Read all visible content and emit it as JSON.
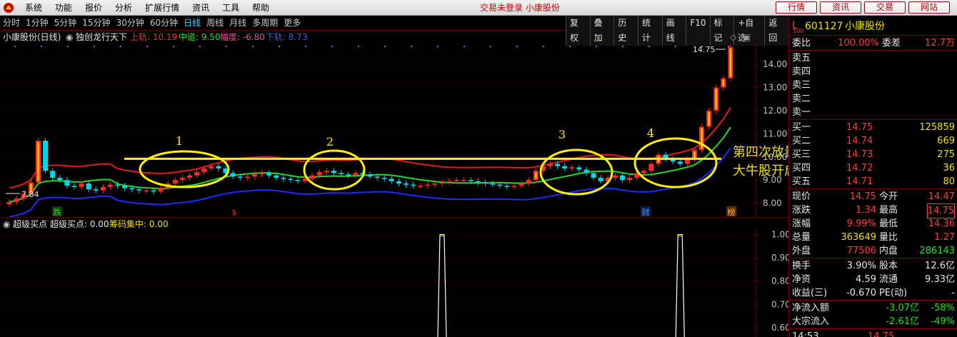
{
  "menu": {
    "items": [
      "系统",
      "功能",
      "报价",
      "分析",
      "扩展行情",
      "资讯",
      "工具",
      "帮助"
    ],
    "status": "交易未登录  小康股份",
    "right_buttons": [
      "行情",
      "资讯",
      "交易",
      "网站"
    ]
  },
  "periodbar": {
    "tabs": [
      "分时",
      "1分钟",
      "5分钟",
      "15分钟",
      "30分钟",
      "60分钟",
      "日线",
      "周线",
      "月线",
      "多周期",
      "更多"
    ],
    "active": "日线",
    "tools": [
      "复权",
      "叠加",
      "历史",
      "统计",
      "画线",
      "F10",
      "标记",
      "+自选",
      "返回"
    ]
  },
  "chart_header": {
    "title": "小康股份(日线)",
    "indicator": "独创龙行天下",
    "upper_label": "上轨: 10.19",
    "mid_label": "中道: 9.50",
    "amp_label": "幅度: -6.80",
    "lower_label": "下轨: 8.73"
  },
  "annotations": {
    "circle_labels": [
      "1",
      "2",
      "3",
      "4"
    ],
    "note_line1": "第四次放量站上红线",
    "note_line2": "大牛股开启",
    "price_high_label": "14.75",
    "price_low_label": "7.84",
    "bottom_markers": [
      "跌",
      "$",
      "财",
      "榜"
    ]
  },
  "sub_header": {
    "name": "超级买点",
    "value_label": "超级买点: 0.00",
    "chip_label": "筹码集中: 0.00"
  },
  "chart_data": [
    {
      "type": "candlestick",
      "title": "小康股份(日线)",
      "y_axis_ticks": [
        "14.00",
        "13.00",
        "12.00",
        "11.00",
        "10.00",
        "9.00",
        "8.00"
      ],
      "ylim": [
        7.4,
        14.9
      ],
      "closes": [
        8.05,
        8.2,
        8.4,
        8.9,
        10.7,
        9.4,
        9.1,
        9.0,
        8.75,
        8.7,
        8.85,
        8.6,
        8.55,
        8.7,
        8.8,
        8.75,
        8.65,
        8.6,
        8.55,
        8.55,
        8.5,
        8.65,
        8.85,
        9.0,
        9.1,
        9.2,
        9.35,
        9.5,
        9.6,
        9.5,
        9.3,
        9.15,
        9.1,
        9.15,
        9.25,
        9.3,
        9.2,
        9.1,
        9.05,
        9.0,
        8.95,
        9.05,
        9.2,
        9.35,
        9.4,
        9.3,
        9.25,
        9.2,
        9.3,
        9.25,
        9.15,
        9.1,
        9.05,
        8.95,
        8.85,
        8.8,
        8.75,
        8.75,
        8.8,
        8.85,
        8.9,
        8.95,
        9.0,
        9.0,
        8.95,
        8.9,
        8.85,
        8.8,
        8.75,
        8.7,
        8.75,
        8.85,
        9.0,
        9.4,
        9.6,
        9.7,
        9.6,
        9.5,
        9.55,
        9.45,
        9.3,
        9.1,
        8.95,
        9.1,
        9.2,
        9.0,
        9.1,
        9.3,
        9.4,
        9.7,
        10.1,
        9.9,
        9.8,
        9.7,
        9.9,
        10.3,
        11.3,
        12.0,
        13.0,
        13.4,
        14.75
      ],
      "series": [
        {
          "name": "上轨",
          "last_value": 10.19,
          "color": "#e01b1b"
        },
        {
          "name": "中道",
          "last_value": 9.5,
          "color": "#22d822"
        },
        {
          "name": "下轨",
          "last_value": 8.73,
          "color": "#1c2cff"
        }
      ]
    },
    {
      "type": "line",
      "title": "超级买点",
      "y_axis_ticks": [
        "1.00",
        "0.90",
        "0.80",
        "0.70",
        "0.60"
      ],
      "ylim": [
        0.56,
        1.02
      ],
      "spikes_at_bar": [
        60,
        93
      ]
    }
  ],
  "quote": {
    "prefix": "L",
    "prefix_sub": "500",
    "code": "601127",
    "name": "小康股份",
    "weibi_label": "委比",
    "weibi": "100.00%",
    "weicha_label": "委差",
    "weicha": "12.7万",
    "asks": [
      {
        "label": "卖五",
        "price": "",
        "vol": ""
      },
      {
        "label": "卖四",
        "price": "",
        "vol": ""
      },
      {
        "label": "卖三",
        "price": "",
        "vol": ""
      },
      {
        "label": "卖二",
        "price": "",
        "vol": ""
      },
      {
        "label": "卖一",
        "price": "",
        "vol": ""
      }
    ],
    "bids": [
      {
        "label": "买一",
        "price": "14.75",
        "vol": "125859"
      },
      {
        "label": "买二",
        "price": "14.74",
        "vol": "669"
      },
      {
        "label": "买三",
        "price": "14.73",
        "vol": "275"
      },
      {
        "label": "买四",
        "price": "14.72",
        "vol": "36"
      },
      {
        "label": "买五",
        "price": "14.71",
        "vol": "80"
      }
    ],
    "stats": [
      {
        "l1": "现价",
        "v1": "14.75",
        "c1": "red",
        "l2": "今开",
        "v2": "14.47",
        "c2": "red"
      },
      {
        "l1": "涨跌",
        "v1": "1.34",
        "c1": "red",
        "l2": "最高",
        "v2": "14.75",
        "c2": "red"
      },
      {
        "l1": "涨幅",
        "v1": "9.99%",
        "c1": "red",
        "l2": "最低",
        "v2": "14.36",
        "c2": "red"
      },
      {
        "l1": "总量",
        "v1": "363649",
        "c1": "yellow",
        "l2": "量比",
        "v2": "1.27",
        "c2": "red"
      },
      {
        "l1": "外盘",
        "v1": "77506",
        "c1": "red",
        "l2": "内盘",
        "v2": "286143",
        "c2": "green"
      }
    ],
    "stats2": [
      {
        "l1": "换手",
        "v1": "3.90%",
        "l2": "股本",
        "v2": "12.6亿"
      },
      {
        "l1": "净资",
        "v1": "4.59",
        "l2": "流通",
        "v2": "9.33亿"
      },
      {
        "l1": "收益(三)",
        "v1": "-0.670",
        "l2": "PE(动)",
        "v2": "-"
      }
    ],
    "flows": [
      {
        "label": "净流入额",
        "v1": "-3.07亿",
        "v2": "-58%"
      },
      {
        "label": "大宗流入",
        "v1": "-2.61亿",
        "v2": "-49%"
      }
    ],
    "tick_row": {
      "time": "14:53",
      "price": "14.75"
    }
  }
}
